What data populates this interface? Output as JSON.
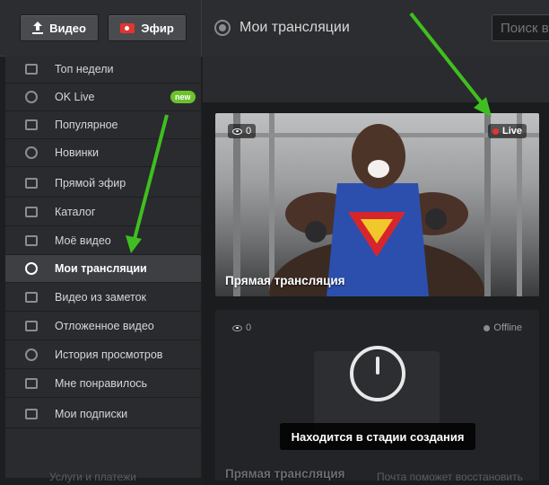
{
  "topbar": {
    "video_button": "Видео",
    "efir_button": "Эфир",
    "page_title": "Мои трансляции",
    "search_placeholder": "Поиск в"
  },
  "sidebar": {
    "items": [
      {
        "label": "Топ недели",
        "icon": "chart-icon"
      },
      {
        "label": "OK Live",
        "icon": "ok-live-icon",
        "badge": "new"
      },
      {
        "label": "Популярное",
        "icon": "film-icon"
      },
      {
        "label": "Новинки",
        "icon": "star-icon"
      },
      {
        "label": "Прямой эфир",
        "icon": "camera-icon"
      },
      {
        "label": "Каталог",
        "icon": "catalog-icon"
      },
      {
        "label": "Моё видео",
        "icon": "user-icon"
      },
      {
        "label": "Мои трансляции",
        "icon": "broadcast-icon",
        "active": true
      },
      {
        "label": "Видео из заметок",
        "icon": "share-icon"
      },
      {
        "label": "Отложенное видео",
        "icon": "clock-film-icon"
      },
      {
        "label": "История просмотров",
        "icon": "history-icon"
      },
      {
        "label": "Мне понравилось",
        "icon": "like-icon"
      },
      {
        "label": "Мои подписки",
        "icon": "subscriptions-icon"
      }
    ],
    "footer_partial": "Услуги и платежи"
  },
  "cards": [
    {
      "views": "0",
      "status": "Live",
      "title": "Прямая трансляция"
    },
    {
      "views": "0",
      "status": "Offline",
      "title": "Прямая трансляция",
      "overlay": "Находится в стадии создания"
    }
  ],
  "bottom_partial_text": "Почта поможет восстановить",
  "colors": {
    "accent_green": "#6cc22d",
    "live_red": "#e3342f",
    "arrow_green": "#3fbf1f"
  }
}
